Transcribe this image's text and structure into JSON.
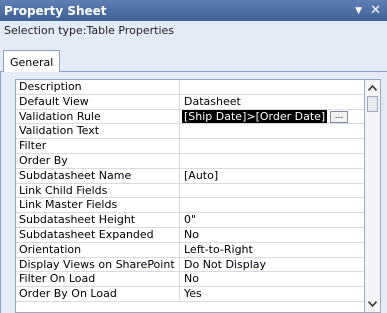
{
  "window": {
    "title": "Property Sheet",
    "dropdown_icon": "chevron-down-icon",
    "close_icon": "close-icon"
  },
  "selection": {
    "label": "Selection type:",
    "value": "Table Properties"
  },
  "tabs": [
    {
      "label": "General",
      "active": true
    }
  ],
  "properties": [
    {
      "name": "Description",
      "value": ""
    },
    {
      "name": "Default View",
      "value": "Datasheet"
    },
    {
      "name": "Validation Rule",
      "value": "[Ship Date]>[Order Date]",
      "selected": true
    },
    {
      "name": "Validation Text",
      "value": ""
    },
    {
      "name": "Filter",
      "value": ""
    },
    {
      "name": "Order By",
      "value": ""
    },
    {
      "name": "Subdatasheet Name",
      "value": "[Auto]"
    },
    {
      "name": "Link Child Fields",
      "value": ""
    },
    {
      "name": "Link Master Fields",
      "value": ""
    },
    {
      "name": "Subdatasheet Height",
      "value": "0\""
    },
    {
      "name": "Subdatasheet Expanded",
      "value": "No"
    },
    {
      "name": "Orientation",
      "value": "Left-to-Right"
    },
    {
      "name": "Display Views on SharePoint",
      "value": "Do Not Display"
    },
    {
      "name": "Filter On Load",
      "value": "No"
    },
    {
      "name": "Order By On Load",
      "value": "Yes"
    }
  ],
  "build_button": {
    "label": "..."
  },
  "scrollbar": {
    "up_icon": "scroll-up-icon",
    "down_icon": "scroll-down-icon"
  },
  "colors": {
    "titlebar": "#3f6296",
    "panel": "#e3ebf6",
    "selected_text_bg": "#000000"
  }
}
